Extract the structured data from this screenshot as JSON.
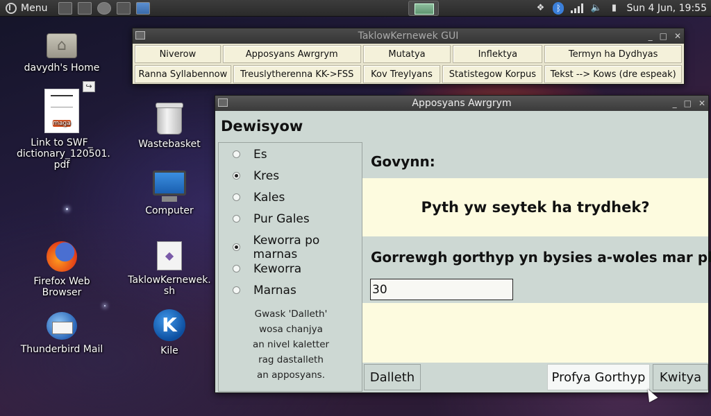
{
  "panel": {
    "menu_label": "Menu",
    "clock": "Sun  4 Jun, 19:55",
    "tray_icons": [
      "dropbox-icon",
      "bluetooth-icon",
      "network-signal-icon",
      "volume-icon",
      "battery-icon"
    ],
    "launchers": [
      "show-desktop-icon",
      "terminal-icon",
      "files-icon",
      "browser-icon",
      "window-icon"
    ]
  },
  "desktop": {
    "icons": [
      {
        "label": "davydh's Home",
        "icon": "home-folder-icon"
      },
      {
        "label": "Link to SWF_ dictionary_120501. pdf",
        "icon": "pdf-file-icon",
        "thumb_text": "maga"
      },
      {
        "label": "Wastebasket",
        "icon": "trash-icon"
      },
      {
        "label": "Computer",
        "icon": "computer-icon"
      },
      {
        "label": "Firefox Web Browser",
        "icon": "firefox-icon"
      },
      {
        "label": "TaklowKernewek. sh",
        "icon": "script-file-icon"
      },
      {
        "label": "Thunderbird Mail",
        "icon": "thunderbird-icon"
      },
      {
        "label": "Kile",
        "icon": "kile-icon",
        "glyph": "K"
      }
    ]
  },
  "gui_window": {
    "title": "TaklowKernewek GUI",
    "row1": [
      "Niverow",
      "Apposyans Awrgrym",
      "Mutatya",
      "Inflektya",
      "Termyn ha Dydhyas"
    ],
    "row2": [
      "Ranna Syllabennow",
      "Treuslytherenna KK->FSS",
      "Kov Treylyans",
      "Statistegow Korpus",
      "Tekst --> Kows (dre espeak)"
    ]
  },
  "app_window": {
    "title": "Apposyans Awrgrym",
    "options_title": "Dewisyow",
    "difficulty": [
      {
        "label": "Es",
        "selected": false
      },
      {
        "label": "Kres",
        "selected": true
      },
      {
        "label": "Kales",
        "selected": false
      },
      {
        "label": "Pur Gales",
        "selected": false
      }
    ],
    "mode": [
      {
        "label": "Keworra po marnas",
        "selected": true
      },
      {
        "label": "Keworra",
        "selected": false
      },
      {
        "label": "Marnas",
        "selected": false
      }
    ],
    "hint_lines": [
      "Gwask 'Dalleth'",
      "wosa chanjya",
      "an nivel kaletter",
      "rag dastalleth",
      "an apposyans."
    ],
    "question_label": "Govynn:",
    "question": "Pyth yw seytek ha trydhek?",
    "instruction": "Gorrewgh gorthyp yn bysies a-woles mar pleg:",
    "answer_value": "30",
    "buttons": {
      "start": "Dalleth",
      "check": "Profya Gorthyp",
      "quit": "Kwitya"
    }
  },
  "colors": {
    "app_bg": "#cdd8d3",
    "question_bg": "#fdfbdf",
    "gui_bg": "#e8e5cf",
    "button_bg": "#f4f1da"
  }
}
